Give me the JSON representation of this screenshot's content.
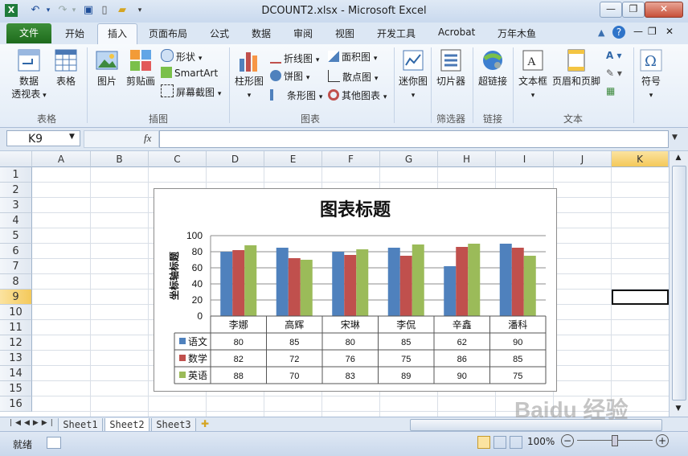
{
  "window": {
    "title": "DCOUNT2.xlsx - Microsoft Excel",
    "buttons": {
      "minimize": "—",
      "restore": "❐",
      "close": "✕"
    }
  },
  "ribbon_tabs": [
    "文件",
    "开始",
    "插入",
    "页面布局",
    "公式",
    "数据",
    "审阅",
    "视图",
    "开发工具",
    "Acrobat",
    "万年木鱼"
  ],
  "ribbon": {
    "pivot_line1": "数据",
    "pivot_line2": "透视表",
    "table": "表格",
    "picture": "图片",
    "clipart": "剪贴画",
    "shapes": "形状",
    "smartart": "SmartArt",
    "screenshot": "屏幕截图",
    "column_chart": "柱形图",
    "line_chart": "折线图",
    "pie_chart": "饼图",
    "bar_chart": "条形图",
    "area_chart": "面积图",
    "scatter_chart": "散点图",
    "other_chart": "其他图表",
    "sparkline": "迷你图",
    "slicer": "切片器",
    "hyperlink": "超链接",
    "textbox": "文本框",
    "header_footer": "页眉和页脚",
    "symbol": "符号",
    "groups": {
      "tables": "表格",
      "illustrations": "插图",
      "charts": "图表",
      "filter": "筛选器",
      "links": "链接",
      "text": "文本"
    }
  },
  "formula_bar": {
    "name_box": "K9",
    "fx": "fx",
    "formula": ""
  },
  "columns": [
    "A",
    "B",
    "C",
    "D",
    "E",
    "F",
    "G",
    "H",
    "I",
    "J",
    "K"
  ],
  "rows": [
    "1",
    "2",
    "3",
    "4",
    "5",
    "6",
    "7",
    "8",
    "9",
    "10",
    "11",
    "12",
    "13",
    "14",
    "15",
    "16"
  ],
  "selected_cell": "K9",
  "chart_data": {
    "type": "bar",
    "title": "图表标题",
    "ylabel": "坐标轴标题",
    "xlabel": "",
    "categories": [
      "李娜",
      "高辉",
      "宋琳",
      "李侃",
      "辛鑫",
      "潘科"
    ],
    "ylim": [
      0,
      100
    ],
    "yticks": [
      0,
      20,
      40,
      60,
      80,
      100
    ],
    "grid": true,
    "legend": "data-table",
    "series": [
      {
        "name": "语文",
        "values": [
          80,
          85,
          80,
          85,
          62,
          90
        ],
        "color": "#4f81bd"
      },
      {
        "name": "数学",
        "values": [
          82,
          72,
          76,
          75,
          86,
          85
        ],
        "color": "#c0504d"
      },
      {
        "name": "英语",
        "values": [
          88,
          70,
          83,
          89,
          90,
          75
        ],
        "color": "#9bbb59"
      }
    ]
  },
  "sheets": [
    "Sheet1",
    "Sheet2",
    "Sheet3"
  ],
  "active_sheet": "Sheet2",
  "status": {
    "ready": "就绪",
    "zoom": "100%"
  },
  "watermark": "Baidu 经验"
}
